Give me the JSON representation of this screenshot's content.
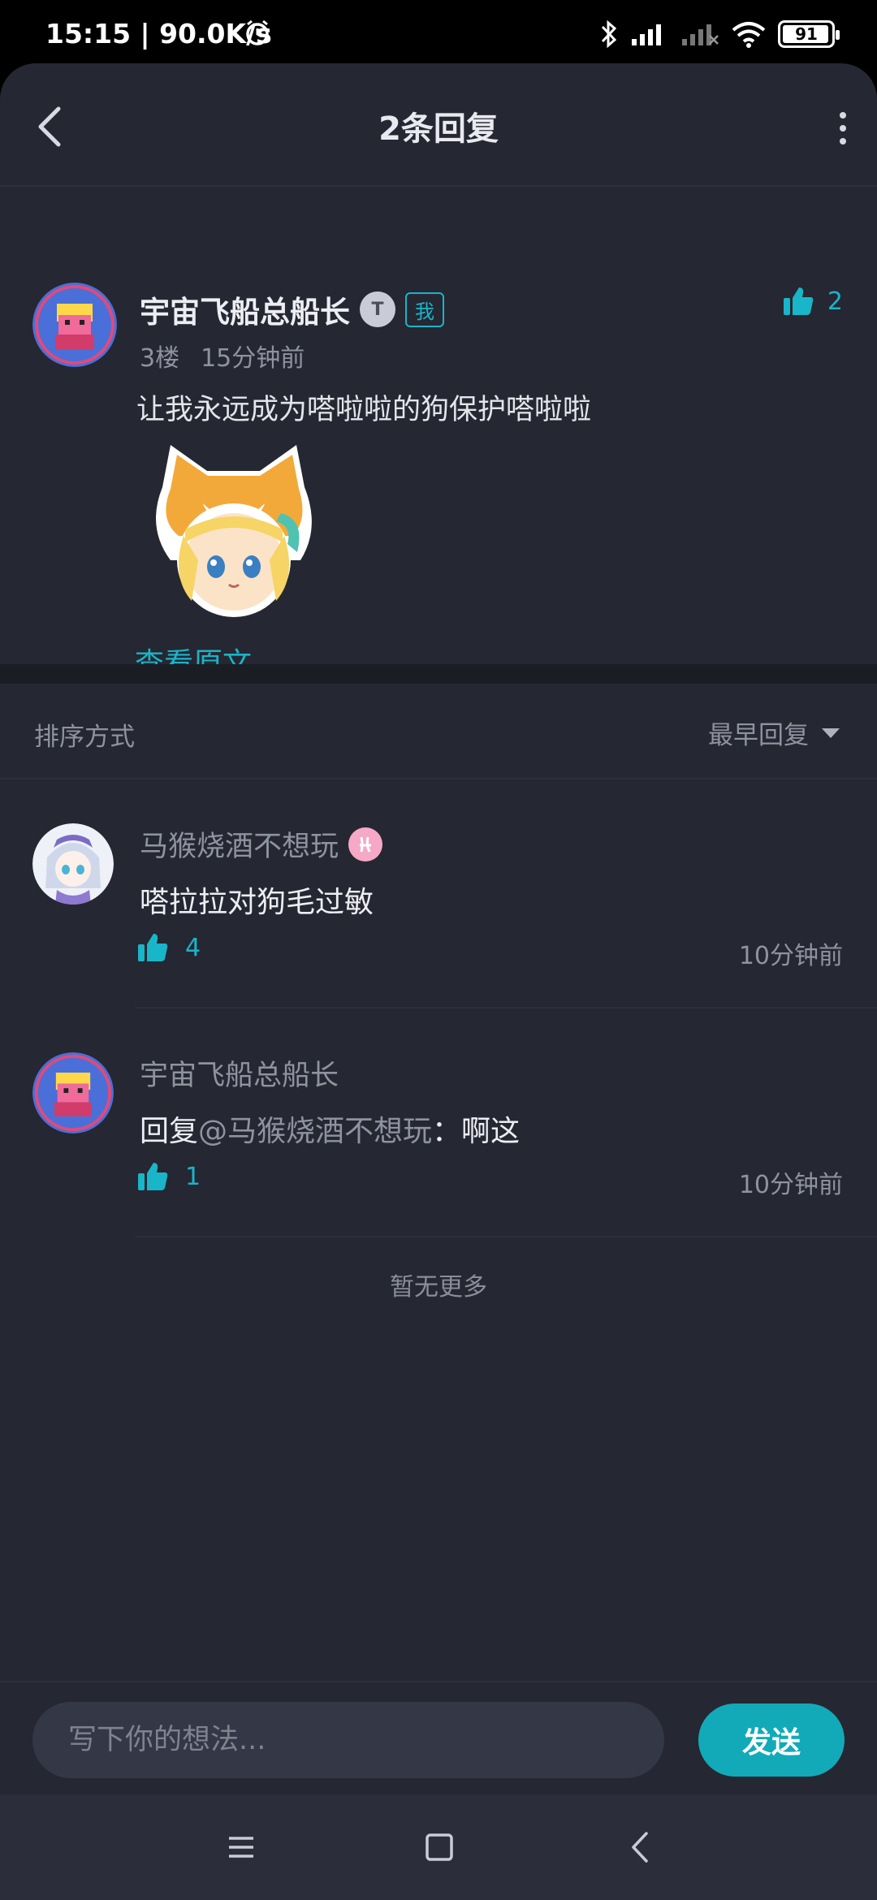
{
  "status_bar": {
    "time": "15:15 | 90.0K/s",
    "battery": "91"
  },
  "header": {
    "title": "2条回复"
  },
  "main_comment": {
    "author": "宇宙飞船总船长",
    "level_badge": "T",
    "me_tag": "我",
    "floor": "3楼",
    "time": "15分钟前",
    "text": "让我永远成为嗒啦啦的狗保护嗒啦啦",
    "likes": "2",
    "view_original": "查看原文"
  },
  "sort": {
    "label": "排序方式",
    "selected": "最早回复"
  },
  "replies": [
    {
      "author": "马猴烧酒不想玩",
      "text": "嗒拉拉对狗毛过敏",
      "likes": "4",
      "time": "10分钟前"
    },
    {
      "author": "宇宙飞船总船长",
      "reply_prefix": "回复",
      "mention": "@马猴烧酒不想玩",
      "text": "：啊这",
      "likes": "1",
      "time": "10分钟前"
    }
  ],
  "no_more": "暂无更多",
  "input": {
    "placeholder": "写下你的想法..."
  },
  "send_label": "发送",
  "colors": {
    "accent": "#19b5c8",
    "background": "#252732"
  }
}
